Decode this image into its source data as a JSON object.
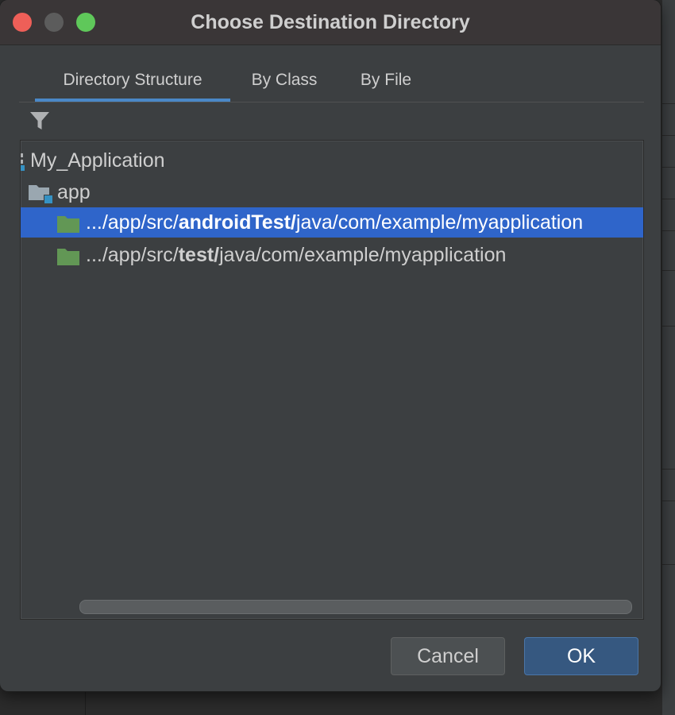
{
  "dialog": {
    "title": "Choose Destination Directory",
    "tabs": [
      {
        "label": "Directory Structure",
        "active": true
      },
      {
        "label": "By Class",
        "active": false
      },
      {
        "label": "By File",
        "active": false
      }
    ],
    "filter_icon": "filter-icon",
    "tree": [
      {
        "label": "My_Application",
        "icon": "module-icon",
        "level": 0
      },
      {
        "label": "app",
        "icon": "module-folder-icon",
        "level": 1
      },
      {
        "prefix": ".../app/src/",
        "bold": "androidTest/",
        "suffix": "java/com/example/myapplication",
        "icon": "test-folder-icon",
        "selected": true
      },
      {
        "prefix": ".../app/src/",
        "bold": "test/",
        "suffix": "java/com/example/myapplication",
        "icon": "test-folder-icon",
        "selected": false
      }
    ],
    "buttons": {
      "cancel": "Cancel",
      "ok": "OK"
    }
  },
  "colors": {
    "selection": "#2f65ca",
    "accent": "#4a88c7",
    "test_folder": "#629755",
    "ok_button": "#365880"
  }
}
